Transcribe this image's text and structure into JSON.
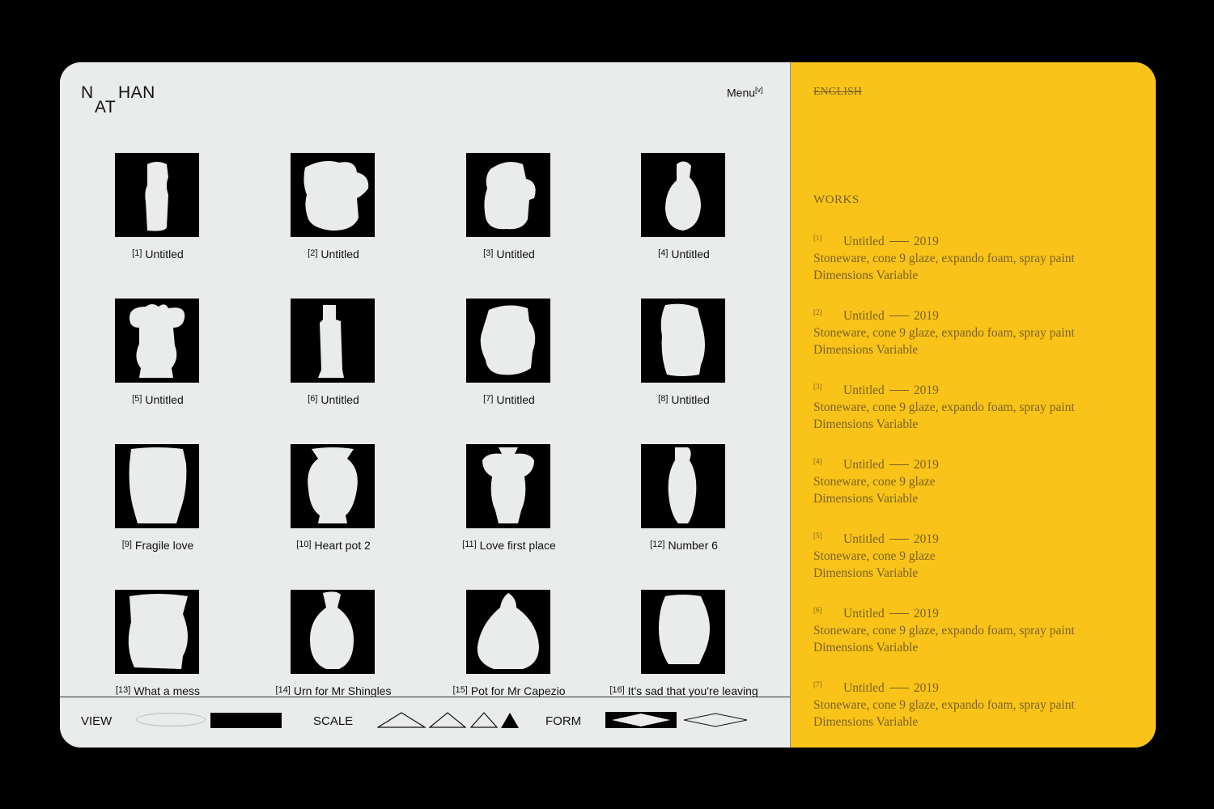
{
  "logo": {
    "n": "N",
    "at": "AT",
    "han": "HAN"
  },
  "menu": {
    "label": "Menu",
    "sup": "[v]"
  },
  "grid": [
    {
      "num": "[1]",
      "title": "Untitled"
    },
    {
      "num": "[2]",
      "title": "Untitled"
    },
    {
      "num": "[3]",
      "title": "Untitled"
    },
    {
      "num": "[4]",
      "title": "Untitled"
    },
    {
      "num": "[5]",
      "title": "Untitled"
    },
    {
      "num": "[6]",
      "title": "Untitled"
    },
    {
      "num": "[7]",
      "title": "Untitled"
    },
    {
      "num": "[8]",
      "title": "Untitled"
    },
    {
      "num": "[9]",
      "title": "Fragile love"
    },
    {
      "num": "[10]",
      "title": "Heart pot 2"
    },
    {
      "num": "[11]",
      "title": "Love first place"
    },
    {
      "num": "[12]",
      "title": "Number 6"
    },
    {
      "num": "[13]",
      "title": "What a mess"
    },
    {
      "num": "[14]",
      "title": "Urn for Mr Shingles"
    },
    {
      "num": "[15]",
      "title": "Pot for Mr Capezio"
    },
    {
      "num": "[16]",
      "title": "It's sad that you're leaving"
    }
  ],
  "toolbar": {
    "view": "VIEW",
    "scale": "SCALE",
    "form": "FORM"
  },
  "sidebar": {
    "language": "ENGLISH",
    "works_title": "WORKS",
    "works": [
      {
        "num": "[1]",
        "title": "Untitled",
        "year": "2019",
        "materials": "Stoneware, cone 9 glaze, expando foam, spray paint",
        "dimensions": "Dimensions Variable"
      },
      {
        "num": "[2]",
        "title": "Untitled",
        "year": "2019",
        "materials": "Stoneware, cone 9 glaze, expando foam, spray paint",
        "dimensions": "Dimensions Variable"
      },
      {
        "num": "[3]",
        "title": "Untitled",
        "year": "2019",
        "materials": "Stoneware, cone 9 glaze, expando foam, spray paint",
        "dimensions": "Dimensions Variable"
      },
      {
        "num": "[4]",
        "title": "Untitled",
        "year": "2019",
        "materials": "Stoneware, cone 9 glaze",
        "dimensions": "Dimensions Variable"
      },
      {
        "num": "[5]",
        "title": "Untitled",
        "year": "2019",
        "materials": "Stoneware, cone 9 glaze",
        "dimensions": "Dimensions Variable"
      },
      {
        "num": "[6]",
        "title": "Untitled",
        "year": "2019",
        "materials": "Stoneware, cone 9 glaze, expando foam, spray paint",
        "dimensions": "Dimensions Variable"
      },
      {
        "num": "[7]",
        "title": "Untitled",
        "year": "2019",
        "materials": "Stoneware, cone 9 glaze, expando foam, spray paint",
        "dimensions": "Dimensions Variable"
      }
    ]
  },
  "colors": {
    "panel": "#e9ecea",
    "accent": "#f9c31a",
    "sidebar_text": "#7a6320",
    "thumb_bg": "#000000",
    "silhouette": "#e9ecea"
  },
  "icons": {
    "thumbnail": "vase-silhouette-icon",
    "view_list": "oval-icon",
    "view_grid": "rectangle-icon",
    "scale": "triangle-icon",
    "form": "diamond-icon"
  }
}
